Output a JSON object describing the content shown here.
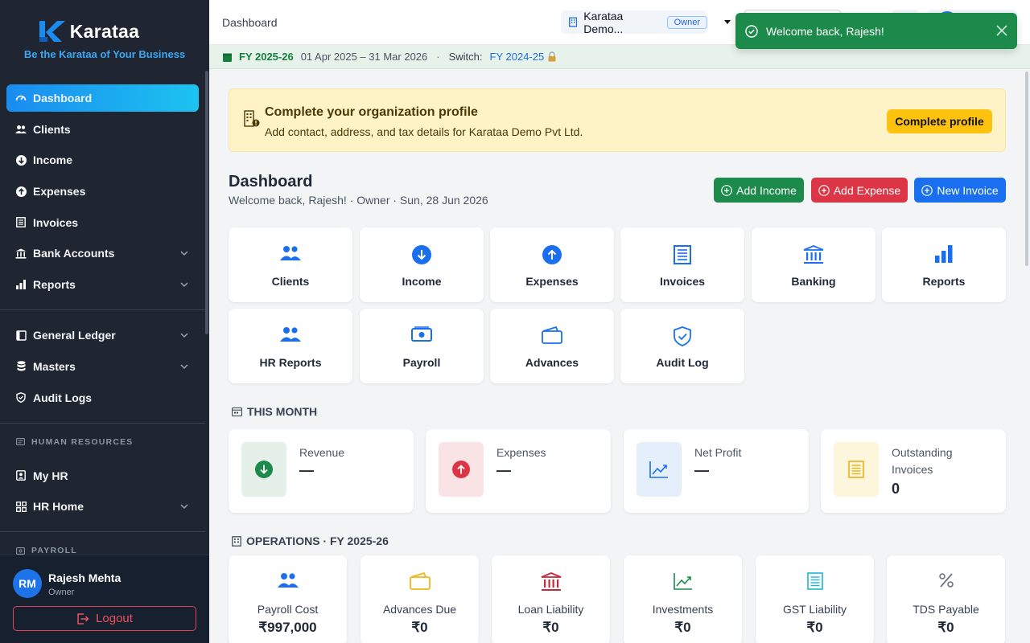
{
  "brand": {
    "name": "Karataa",
    "tagline": "Be the Karataa of Your Business"
  },
  "sidebar": {
    "items": [
      {
        "label": "Dashboard",
        "icon": "gauge-icon"
      },
      {
        "label": "Clients",
        "icon": "users-icon"
      },
      {
        "label": "Income",
        "icon": "arrow-down-circle-icon"
      },
      {
        "label": "Expenses",
        "icon": "arrow-up-circle-icon"
      },
      {
        "label": "Invoices",
        "icon": "receipt-icon"
      },
      {
        "label": "Bank Accounts",
        "icon": "bank-icon"
      },
      {
        "label": "Reports",
        "icon": "bar-chart-icon"
      }
    ],
    "items2": [
      {
        "label": "General Ledger",
        "icon": "book-icon"
      },
      {
        "label": "Masters",
        "icon": "database-icon"
      },
      {
        "label": "Audit Logs",
        "icon": "shield-icon"
      }
    ],
    "hr_heading": "HUMAN RESOURCES",
    "hr_items": [
      {
        "label": "My HR",
        "icon": "id-badge-icon"
      },
      {
        "label": "HR Home",
        "icon": "grid-icon"
      }
    ],
    "payroll_heading": "PAYROLL"
  },
  "user": {
    "initials": "RM",
    "name": "Rajesh Mehta",
    "role": "Owner",
    "logout": "Logout"
  },
  "topbar": {
    "breadcrumb": "Dashboard",
    "org_name": "Karataa Demo...",
    "org_role": "Owner"
  },
  "fy": {
    "current": "FY 2025-26",
    "range": "01 Apr 2025 – 31 Mar 2026",
    "switch_label": "Switch:",
    "previous": "FY 2024-25"
  },
  "banner": {
    "title": "Complete your organization profile",
    "subtitle": "Add contact, address, and tax details for Karataa Demo Pvt Ltd.",
    "button": "Complete profile"
  },
  "header": {
    "title": "Dashboard",
    "subtitle": "Welcome back, Rajesh! · Owner · Sun, 28 Jun 2026",
    "add_income": "Add Income",
    "add_expense": "Add Expense",
    "new_invoice": "New Invoice"
  },
  "tiles": [
    "Clients",
    "Income",
    "Expenses",
    "Invoices",
    "Banking",
    "Reports",
    "HR Reports",
    "Payroll",
    "Advances",
    "Audit Log"
  ],
  "this_month": {
    "heading": "THIS MONTH",
    "stats": [
      {
        "label": "Revenue",
        "value": "—"
      },
      {
        "label": "Expenses",
        "value": "—"
      },
      {
        "label": "Net Profit",
        "value": "—"
      },
      {
        "label": "Outstanding Invoices",
        "value": "0"
      }
    ]
  },
  "operations": {
    "heading": "OPERATIONS · FY 2025-26",
    "cards": [
      {
        "label": "Payroll Cost",
        "value": "₹997,000"
      },
      {
        "label": "Advances Due",
        "value": "₹0"
      },
      {
        "label": "Loan Liability",
        "value": "₹0"
      },
      {
        "label": "Investments",
        "value": "₹0"
      },
      {
        "label": "GST Liability",
        "value": "₹0"
      },
      {
        "label": "TDS Payable",
        "value": "₹0"
      }
    ]
  },
  "toast": {
    "message": "Welcome back, Rajesh!"
  },
  "colors": {
    "accent": "#1a8cf0",
    "success": "#1c8a4a",
    "danger": "#dc3545",
    "warning": "#fcc20e",
    "sidebar": "#1f2631"
  }
}
